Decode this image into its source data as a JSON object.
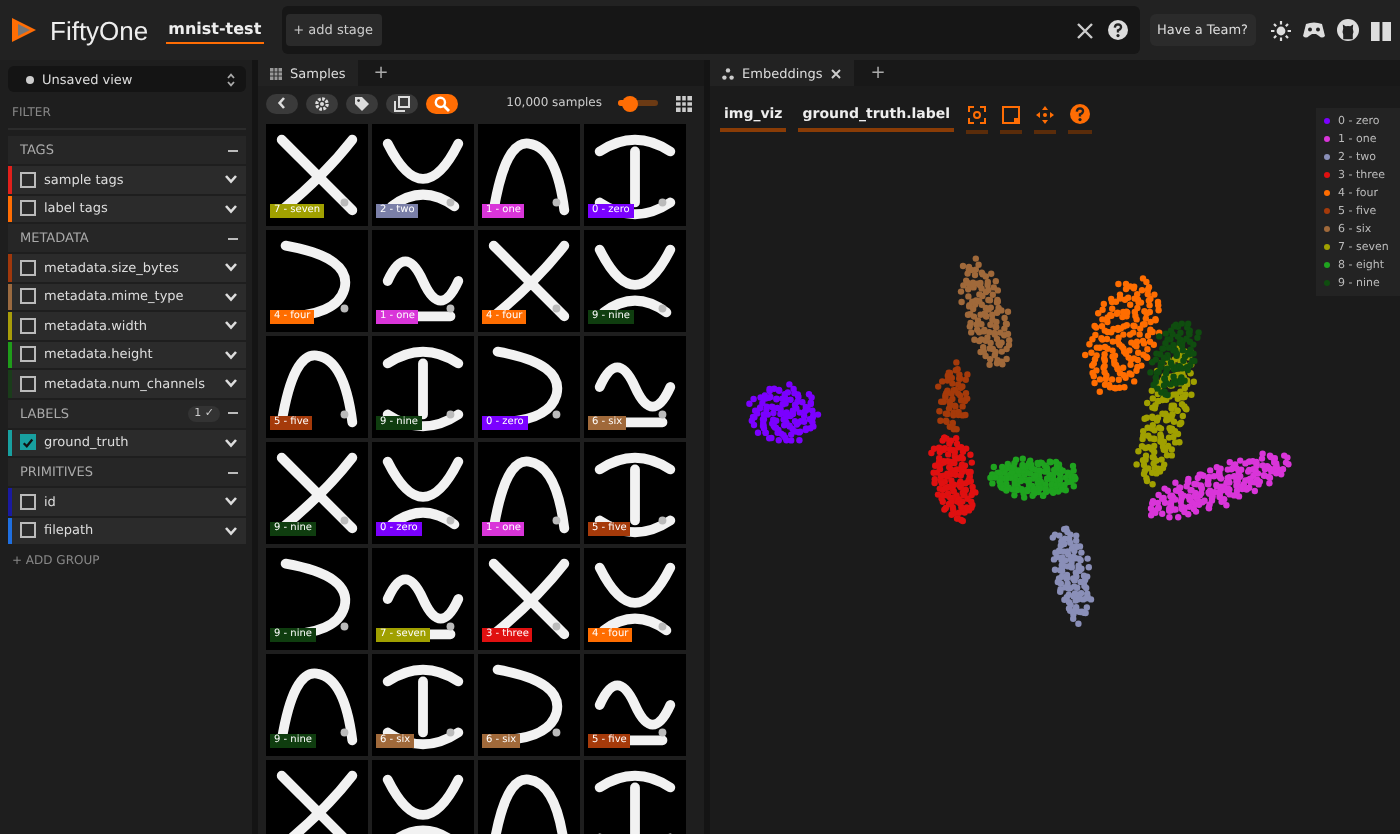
{
  "header": {
    "app_name": "FiftyOne",
    "dataset": "mnist-test",
    "add_stage": "+ add stage",
    "team_button": "Have a Team?"
  },
  "sidebar": {
    "view": "Unsaved view",
    "filter_title": "FILTER",
    "groups": [
      {
        "title": "TAGS",
        "fields": [
          {
            "name": "sample tags",
            "color": "#e0201b",
            "checked": false
          },
          {
            "name": "label tags",
            "color": "#ff6d04",
            "checked": false
          }
        ]
      },
      {
        "title": "METADATA",
        "fields": [
          {
            "name": "metadata.size_bytes",
            "color": "#a0380c",
            "checked": false
          },
          {
            "name": "metadata.mime_type",
            "color": "#9a6a40",
            "checked": false
          },
          {
            "name": "metadata.width",
            "color": "#a89d0a",
            "checked": false
          },
          {
            "name": "metadata.height",
            "color": "#1f9c1a",
            "checked": false
          },
          {
            "name": "metadata.num_channels",
            "color": "#1a3d1a",
            "checked": false
          }
        ]
      },
      {
        "title": "LABELS",
        "badge": "1 ✓",
        "fields": [
          {
            "name": "ground_truth",
            "color": "#18a0a0",
            "checked": true
          }
        ]
      },
      {
        "title": "PRIMITIVES",
        "fields": [
          {
            "name": "id",
            "color": "#1a1aa0",
            "checked": false
          },
          {
            "name": "filepath",
            "color": "#1f6fe0",
            "checked": false
          }
        ]
      }
    ],
    "add_group": "+ ADD GROUP"
  },
  "samples": {
    "tab": "Samples",
    "new_tab": "+",
    "count": "10,000 samples",
    "zoom_slider": {
      "level": 0.3
    },
    "tiles": [
      {
        "label": "7 - seven",
        "color": "#a0a000"
      },
      {
        "label": "2 - two",
        "color": "#7a7fa8"
      },
      {
        "label": "1 - one",
        "color": "#d935d9"
      },
      {
        "label": "0 - zero",
        "color": "#7b00ff"
      },
      {
        "label": "4 - four",
        "color": "#ff6d00"
      },
      {
        "label": "1 - one",
        "color": "#d935d9"
      },
      {
        "label": "4 - four",
        "color": "#ff6d00"
      },
      {
        "label": "9 - nine",
        "color": "#0f3d0f"
      },
      {
        "label": "5 - five",
        "color": "#a53a0a"
      },
      {
        "label": "9 - nine",
        "color": "#0f3d0f"
      },
      {
        "label": "0 - zero",
        "color": "#7b00ff"
      },
      {
        "label": "6 - six",
        "color": "#a0693a"
      },
      {
        "label": "9 - nine",
        "color": "#0f3d0f"
      },
      {
        "label": "0 - zero",
        "color": "#7b00ff"
      },
      {
        "label": "1 - one",
        "color": "#d935d9"
      },
      {
        "label": "5 - five",
        "color": "#a53a0a"
      },
      {
        "label": "9 - nine",
        "color": "#0f3d0f"
      },
      {
        "label": "7 - seven",
        "color": "#a0a000"
      },
      {
        "label": "3 - three",
        "color": "#e01010"
      },
      {
        "label": "4 - four",
        "color": "#ff6d00"
      },
      {
        "label": "9 - nine",
        "color": "#0f3d0f"
      },
      {
        "label": "6 - six",
        "color": "#a0693a"
      },
      {
        "label": "6 - six",
        "color": "#a0693a"
      },
      {
        "label": "5 - five",
        "color": "#a53a0a"
      }
    ]
  },
  "embeddings": {
    "tab": "Embeddings",
    "new_tab": "+",
    "brain_key": "img_viz",
    "color_by": "ground_truth.label",
    "legend": [
      {
        "label": "0 - zero",
        "color": "#7b00ff"
      },
      {
        "label": "1 - one",
        "color": "#d935d9"
      },
      {
        "label": "2 - two",
        "color": "#8a8fb8"
      },
      {
        "label": "3 - three",
        "color": "#e01010"
      },
      {
        "label": "4 - four",
        "color": "#ff6d00"
      },
      {
        "label": "5 - five",
        "color": "#a53a0a"
      },
      {
        "label": "6 - six",
        "color": "#a0693a"
      },
      {
        "label": "7 - seven",
        "color": "#a0a000"
      },
      {
        "label": "8 - eight",
        "color": "#1fa31f"
      },
      {
        "label": "9 - nine",
        "color": "#0f4d0f"
      }
    ]
  }
}
